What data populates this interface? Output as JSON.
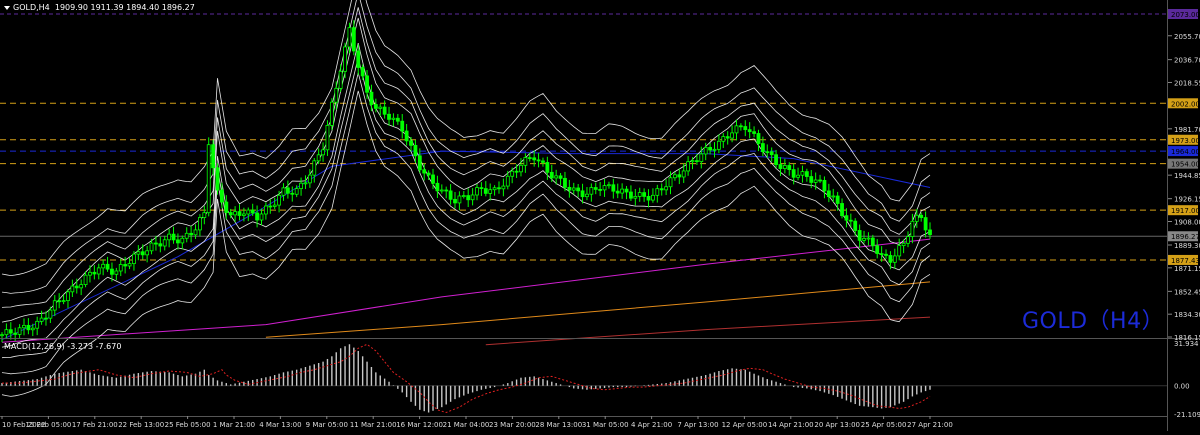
{
  "header": {
    "symbol": "GOLD,H4",
    "ohlc": "1909.90 1911.39 1894.40 1896.27"
  },
  "watermark": "GOLD（H4）",
  "macd": {
    "label": "MACD(12,26,9) -3.273 -7.670",
    "axis_labels": [
      "31.934",
      "0.00",
      "-21.109"
    ]
  },
  "colors": {
    "background": "#000000",
    "bull_candle": "#00ff00",
    "bear_candle": "#ffffff",
    "bands": "#ffffff",
    "ma_blue": "#1a2ad8",
    "ma_magenta": "#d020d0",
    "ma_orange": "#e08a1a",
    "ma_red": "#b03030",
    "level_line": "#d4a017",
    "watermark": "#1c2bd8"
  },
  "chart_data": {
    "type": "line",
    "title": "GOLD,H4",
    "ylim": [
      1816.15,
      2073.0
    ],
    "y_ticks": [
      "2055.70",
      "2036.70",
      "2018.55",
      "1981.70",
      "1944.85",
      "1926.15",
      "1908.00",
      "1889.30",
      "1871.15",
      "1852.45",
      "1834.30",
      "1816.15"
    ],
    "x_ticks": [
      "10 Feb 2022",
      "15 Feb 05:00",
      "17 Feb 21:00",
      "22 Feb 13:00",
      "25 Feb 05:00",
      "1 Mar 21:00",
      "4 Mar 13:00",
      "9 Mar 05:00",
      "11 Mar 21:00",
      "16 Mar 12:00",
      "21 Mar 04:00",
      "23 Mar 20:00",
      "28 Mar 13:00",
      "31 Mar 05:00",
      "4 Apr 21:00",
      "7 Apr 13:00",
      "12 Apr 05:00",
      "14 Apr 21:00",
      "20 Apr 13:00",
      "25 Apr 05:00",
      "27 Apr 21:00"
    ],
    "price_tags": [
      {
        "label": "2073.00",
        "value": 2073.0,
        "color": "#5b2a9c"
      },
      {
        "label": "2002.00",
        "value": 2002.0,
        "color": "#d4a017"
      },
      {
        "label": "1973.00",
        "value": 1973.0,
        "color": "#d4a017"
      },
      {
        "label": "1964.00",
        "value": 1964.0,
        "color": "#1a2ad8"
      },
      {
        "label": "1954.00",
        "value": 1954.0,
        "color": "#777777"
      },
      {
        "label": "1917.00",
        "value": 1917.0,
        "color": "#d4a017"
      },
      {
        "label": "1896.27",
        "value": 1896.27,
        "color": "#888888"
      },
      {
        "label": "1877.43",
        "value": 1877.43,
        "color": "#d4a017"
      }
    ],
    "horizontal_levels": [
      2002.0,
      1973.0,
      1954.0,
      1917.0,
      1877.43
    ],
    "blue_level": 1964.0,
    "close_path": [
      [
        0,
        1818
      ],
      [
        8,
        1826
      ],
      [
        12,
        1842
      ],
      [
        18,
        1860
      ],
      [
        22,
        1872
      ],
      [
        26,
        1868
      ],
      [
        30,
        1880
      ],
      [
        34,
        1888
      ],
      [
        38,
        1895
      ],
      [
        41,
        1893
      ],
      [
        44,
        1903
      ],
      [
        46,
        1914
      ],
      [
        47,
        1972
      ],
      [
        49,
        1930
      ],
      [
        52,
        1912
      ],
      [
        55,
        1916
      ],
      [
        58,
        1912
      ],
      [
        61,
        1920
      ],
      [
        64,
        1932
      ],
      [
        67,
        1932
      ],
      [
        70,
        1946
      ],
      [
        73,
        1968
      ],
      [
        75,
        2000
      ],
      [
        77,
        2030
      ],
      [
        79,
        2060
      ],
      [
        81,
        2032
      ],
      [
        83,
        2010
      ],
      [
        85,
        1998
      ],
      [
        88,
        1992
      ],
      [
        91,
        1982
      ],
      [
        93,
        1966
      ],
      [
        95,
        1952
      ],
      [
        97,
        1942
      ],
      [
        100,
        1932
      ],
      [
        103,
        1925
      ],
      [
        106,
        1928
      ],
      [
        109,
        1934
      ],
      [
        112,
        1932
      ],
      [
        115,
        1942
      ],
      [
        118,
        1954
      ],
      [
        121,
        1960
      ],
      [
        124,
        1948
      ],
      [
        127,
        1940
      ],
      [
        130,
        1932
      ],
      [
        133,
        1930
      ],
      [
        136,
        1936
      ],
      [
        139,
        1934
      ],
      [
        142,
        1930
      ],
      [
        145,
        1928
      ],
      [
        148,
        1928
      ],
      [
        151,
        1938
      ],
      [
        154,
        1946
      ],
      [
        157,
        1956
      ],
      [
        160,
        1964
      ],
      [
        163,
        1970
      ],
      [
        166,
        1980
      ],
      [
        169,
        1984
      ],
      [
        171,
        1975
      ],
      [
        174,
        1962
      ],
      [
        177,
        1952
      ],
      [
        180,
        1946
      ],
      [
        183,
        1944
      ],
      [
        186,
        1938
      ],
      [
        189,
        1926
      ],
      [
        192,
        1910
      ],
      [
        195,
        1896
      ],
      [
        198,
        1890
      ],
      [
        200,
        1880
      ],
      [
        202,
        1878
      ],
      [
        205,
        1890
      ],
      [
        207,
        1908
      ],
      [
        209,
        1912
      ],
      [
        211,
        1896
      ]
    ],
    "moving_averages": [
      {
        "color": "#1a2ad8",
        "points": [
          [
            0,
            1814
          ],
          [
            40,
            1880
          ],
          [
            60,
            1920
          ],
          [
            75,
            1952
          ],
          [
            100,
            1964
          ],
          [
            130,
            1962
          ],
          [
            160,
            1962
          ],
          [
            180,
            1958
          ],
          [
            211,
            1935
          ]
        ]
      },
      {
        "color": "#d020d0",
        "points": [
          [
            0,
            1812
          ],
          [
            60,
            1826
          ],
          [
            100,
            1848
          ],
          [
            160,
            1874
          ],
          [
            211,
            1894
          ]
        ]
      },
      {
        "color": "#e08a1a",
        "points": [
          [
            60,
            1816
          ],
          [
            100,
            1826
          ],
          [
            160,
            1844
          ],
          [
            211,
            1860
          ]
        ]
      },
      {
        "color": "#b03030",
        "points": [
          [
            110,
            1810
          ],
          [
            160,
            1822
          ],
          [
            211,
            1832
          ]
        ]
      }
    ],
    "macd_ylim": [
      -21.109,
      31.934
    ],
    "macd_histogram": [
      [
        0,
        2
      ],
      [
        8,
        5
      ],
      [
        12,
        9
      ],
      [
        18,
        12
      ],
      [
        22,
        8
      ],
      [
        26,
        6
      ],
      [
        30,
        9
      ],
      [
        34,
        11
      ],
      [
        38,
        10
      ],
      [
        41,
        7
      ],
      [
        44,
        9
      ],
      [
        46,
        12
      ],
      [
        47,
        8
      ],
      [
        49,
        4
      ],
      [
        52,
        1
      ],
      [
        55,
        3
      ],
      [
        58,
        5
      ],
      [
        61,
        7
      ],
      [
        64,
        10
      ],
      [
        67,
        12
      ],
      [
        70,
        15
      ],
      [
        73,
        18
      ],
      [
        75,
        22
      ],
      [
        77,
        28
      ],
      [
        79,
        31
      ],
      [
        81,
        26
      ],
      [
        83,
        18
      ],
      [
        85,
        10
      ],
      [
        88,
        3
      ],
      [
        91,
        -5
      ],
      [
        93,
        -12
      ],
      [
        95,
        -18
      ],
      [
        97,
        -20
      ],
      [
        100,
        -16
      ],
      [
        103,
        -10
      ],
      [
        106,
        -6
      ],
      [
        109,
        -3
      ],
      [
        112,
        -1
      ],
      [
        115,
        2
      ],
      [
        118,
        6
      ],
      [
        121,
        7
      ],
      [
        124,
        4
      ],
      [
        127,
        1
      ],
      [
        130,
        -2
      ],
      [
        133,
        -3
      ],
      [
        136,
        -2
      ],
      [
        139,
        -1
      ],
      [
        142,
        -1
      ],
      [
        145,
        0
      ],
      [
        148,
        1
      ],
      [
        151,
        2
      ],
      [
        154,
        4
      ],
      [
        157,
        6
      ],
      [
        160,
        8
      ],
      [
        163,
        11
      ],
      [
        166,
        13
      ],
      [
        169,
        12
      ],
      [
        171,
        9
      ],
      [
        174,
        5
      ],
      [
        177,
        2
      ],
      [
        180,
        -1
      ],
      [
        183,
        -2
      ],
      [
        186,
        -4
      ],
      [
        189,
        -7
      ],
      [
        192,
        -11
      ],
      [
        195,
        -15
      ],
      [
        198,
        -16
      ],
      [
        200,
        -17
      ],
      [
        202,
        -16
      ],
      [
        205,
        -12
      ],
      [
        207,
        -8
      ],
      [
        209,
        -5
      ],
      [
        211,
        -3
      ]
    ]
  }
}
